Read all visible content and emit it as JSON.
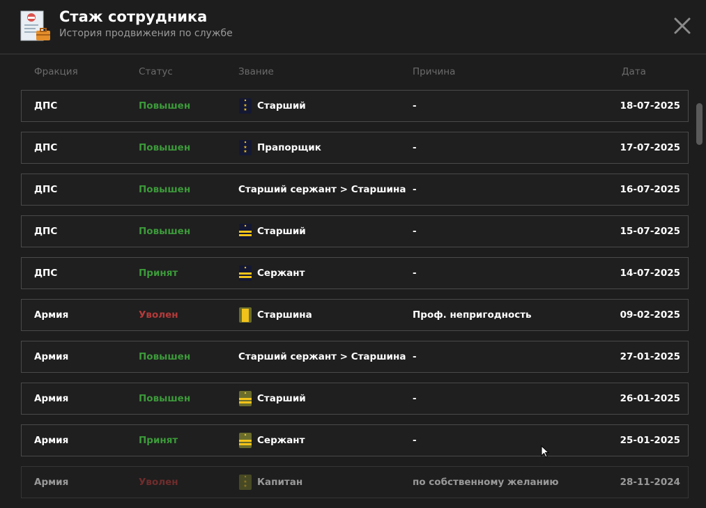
{
  "header": {
    "title": "Стаж сотрудника",
    "subtitle": "История продвижения по службе"
  },
  "columns": {
    "faction": "Фракция",
    "status": "Статус",
    "rank": "Звание",
    "reason": "Причина",
    "date": "Дата"
  },
  "rows": [
    {
      "faction": "ДПС",
      "status": "Повышен",
      "status_kind": "up",
      "rank": "Старший",
      "rank_icon": "dps-star-shoulder-icon",
      "reason": "-",
      "date": "18-07-2025"
    },
    {
      "faction": "ДПС",
      "status": "Повышен",
      "status_kind": "up",
      "rank": "Прапорщик",
      "rank_icon": "dps-star-shoulder-icon",
      "reason": "-",
      "date": "17-07-2025"
    },
    {
      "faction": "ДПС",
      "status": "Повышен",
      "status_kind": "up",
      "rank": "Старший сержант > Старшина",
      "rank_icon": "",
      "reason": "-",
      "date": "16-07-2025"
    },
    {
      "faction": "ДПС",
      "status": "Повышен",
      "status_kind": "up",
      "rank": "Старший",
      "rank_icon": "dps-stripes-shoulder-icon",
      "reason": "-",
      "date": "15-07-2025"
    },
    {
      "faction": "ДПС",
      "status": "Принят",
      "status_kind": "up",
      "rank": "Сержант",
      "rank_icon": "dps-stripes-shoulder-icon",
      "reason": "-",
      "date": "14-07-2025"
    },
    {
      "faction": "Армия",
      "status": "Уволен",
      "status_kind": "fired",
      "rank": "Старшина",
      "rank_icon": "army-yellow-shoulder-icon",
      "reason": "Проф. непригодность",
      "date": "09-02-2025"
    },
    {
      "faction": "Армия",
      "status": "Повышен",
      "status_kind": "up",
      "rank": "Старший сержант > Старшина",
      "rank_icon": "",
      "reason": "-",
      "date": "27-01-2025"
    },
    {
      "faction": "Армия",
      "status": "Повышен",
      "status_kind": "up",
      "rank": "Старший",
      "rank_icon": "army-stripes-shoulder-icon",
      "reason": "-",
      "date": "26-01-2025"
    },
    {
      "faction": "Армия",
      "status": "Принят",
      "status_kind": "up",
      "rank": "Сержант",
      "rank_icon": "army-stripes-shoulder-icon",
      "reason": "-",
      "date": "25-01-2025"
    },
    {
      "faction": "Армия",
      "status": "Уволен",
      "status_kind": "fired",
      "rank": "Капитан",
      "rank_icon": "army-stars-shoulder-icon",
      "reason": "по собственному желанию",
      "date": "28-11-2024"
    }
  ],
  "colors": {
    "status_up": "#3c9a3a",
    "status_fired": "#b43a3a",
    "dps_board": "#141833",
    "army_board": "#6a6d2c",
    "stripe": "#f2c31a"
  }
}
